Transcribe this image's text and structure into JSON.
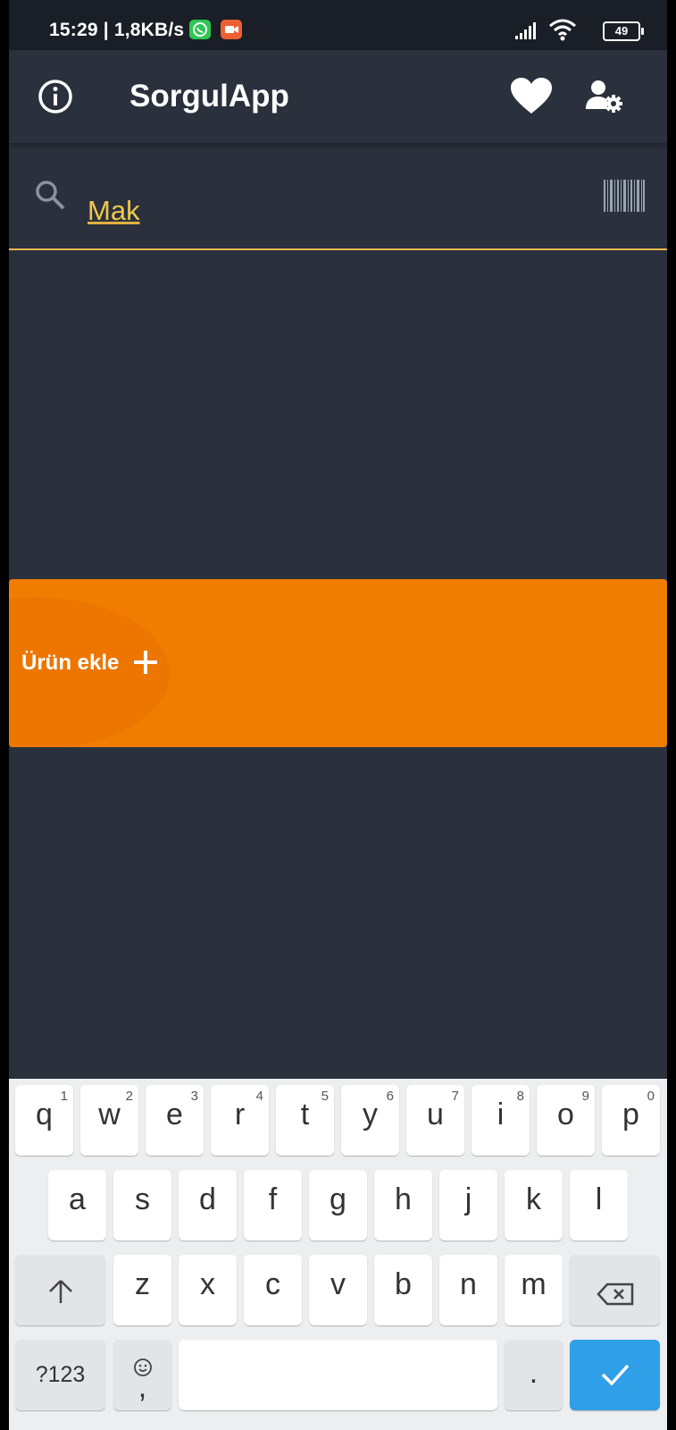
{
  "status_bar": {
    "time": "15:29",
    "speed": "| 1,8KB/s",
    "battery": "49"
  },
  "app_bar": {
    "title": "SorgulApp",
    "icons": [
      "info-icon",
      "heart-icon",
      "user-settings-icon"
    ]
  },
  "search": {
    "value": "Mak",
    "icons": [
      "search-icon",
      "barcode-icon"
    ]
  },
  "add_product": {
    "label": "Ürün ekle"
  },
  "keyboard": {
    "row1": [
      {
        "ch": "q",
        "num": "1"
      },
      {
        "ch": "w",
        "num": "2"
      },
      {
        "ch": "e",
        "num": "3"
      },
      {
        "ch": "r",
        "num": "4"
      },
      {
        "ch": "t",
        "num": "5"
      },
      {
        "ch": "y",
        "num": "6"
      },
      {
        "ch": "u",
        "num": "7"
      },
      {
        "ch": "i",
        "num": "8"
      },
      {
        "ch": "o",
        "num": "9"
      },
      {
        "ch": "p",
        "num": "0"
      }
    ],
    "row2": [
      "a",
      "s",
      "d",
      "f",
      "g",
      "h",
      "j",
      "k",
      "l"
    ],
    "row3": [
      "z",
      "x",
      "c",
      "v",
      "b",
      "n",
      "m"
    ],
    "symbols_label": "?123",
    "comma": ",",
    "period": "."
  },
  "colors": {
    "background": "#2a313d",
    "accent": "#f1c84b",
    "banner": "#f07d00",
    "enter_key": "#2f9fe8"
  }
}
